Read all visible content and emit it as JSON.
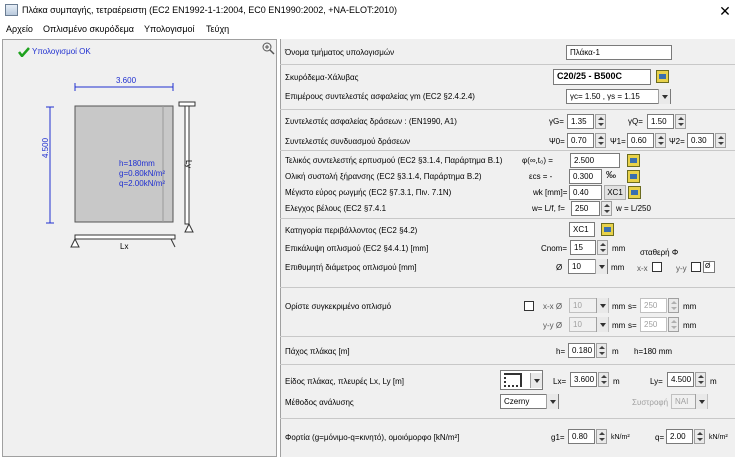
{
  "window": {
    "title": "Πλάκα συμπαγής, τετραέρειστη (EC2 EN1992-1-1:2004, EC0 EN1990:2002, +NA-ELOT:2010)",
    "close_symbol": "✕"
  },
  "menu": {
    "file": "Αρχείο",
    "rebar": "Οπλισμένο σκυρόδεμα",
    "calc": "Υπολογισμοί",
    "docs": "Τεύχη"
  },
  "left": {
    "status": "Υπολογισμοί ΟΚ",
    "dim_top": "3.600",
    "dim_left": "4.500",
    "h_text": "h=180mm",
    "g_text": "g=0.80kN/m²",
    "q_text": "q=2.00kN/m²",
    "lx_label": "Lx",
    "ly_label": "Ly",
    "colors": {
      "slab": "#c8c8c8",
      "dim": "#1f2fd0"
    }
  },
  "section_name": {
    "label": "Όνομα τμήματος υπολογισμών",
    "value": "Πλάκα-1"
  },
  "materials": {
    "label": "Σκυρόδεμα-Χάλυβας",
    "value": "C20/25 - B500C",
    "factors_label": "Επιμέρους συντελεστές ασφαλείας γm (EC2 §2.4.2.4)",
    "factors_value": "γc= 1.50 , γs = 1.15"
  },
  "actions": {
    "safety_label": "Συντελεστές ασφαλείας δράσεων : (EN1990, A1)",
    "gG_label": "γG=",
    "gG": "1.35",
    "gQ_label": "γQ=",
    "gQ": "1.50",
    "comb_label": "Συντελεστές συνδυασμού δράσεων",
    "psi0_label": "Ψ0=",
    "psi0": "0.70",
    "psi1_label": "Ψ1=",
    "psi1": "0.60",
    "psi2_label": "Ψ2=",
    "psi2": "0.30"
  },
  "creep": {
    "creep_label": "Τελικός συντελεστής ερπυσμού (EC2 §3.1.4, Παράρτημα Β.1)",
    "creep_sym": "φ(∞,t₀) =",
    "creep_val": "2.500",
    "shrink_label": "Ολική συστολή ξήρανσης (EC2 §3.1.4, Παράρτημα Β.2)",
    "shrink_sym": "εcs = -",
    "shrink_val": "0.300",
    "shrink_unit": "‰",
    "crack_label": "Μέγιστο εύρος ρωγμής (EC2 §7.3.1, Πιν. 7.1Ν)",
    "crack_sym": "wk [mm]=",
    "crack_val": "0.40",
    "crack_class": "XC1",
    "defl_label": "Ελεγχος βέλους (EC2 §7.4.1",
    "defl_sym": "w= L/f, f=",
    "defl_val": "250",
    "defl_result": "w = L/250"
  },
  "cover": {
    "env_label": "Κατηγορία περιβάλλοντος (EC2 §4.2)",
    "env_val": "XC1",
    "cover_label": "Επικάλυψη οπλισμού (EC2 §4.4.1) [mm]",
    "cover_sym": "Cnom=",
    "cover_val": "15",
    "cover_unit": "mm",
    "const_label": "σταθερή Φ",
    "dia_label": "Επιθυμητή διάμετρος οπλισμού [mm]",
    "dia_sym": "Ø",
    "dia_val": "10",
    "dia_unit": "mm",
    "xx_label": "x-x",
    "yy_label": "y-y",
    "dia_icon": "Ø"
  },
  "specific": {
    "label": "Ορίστε συγκεκριμένο οπλισμό",
    "xx_label": "x-x Ø",
    "xx_dia": "10",
    "xx_s": "250",
    "yy_label": "y-y Ø",
    "yy_dia": "10",
    "yy_s": "250",
    "mm": "mm",
    "s": "s="
  },
  "thickness": {
    "label": "Πάχος πλάκας [m]",
    "sym": "h=",
    "val": "0.180",
    "unit": "m",
    "result": "h=180 mm"
  },
  "slab": {
    "label": "Είδος πλάκας, πλευρές Lx, Ly [m]",
    "lx_sym": "Lx=",
    "lx": "3.600",
    "ly_sym": "Ly=",
    "ly": "4.500",
    "unit": "m",
    "method_label": "Μέθοδος ανάλυσης",
    "method": "Czerny",
    "torsion_label": "Συστροφή",
    "torsion": "NAI"
  },
  "loads": {
    "label": "Φορτία (g=μόνιμο-q=κινητό), ομοιόμορφο  [kN/m²]",
    "g1_sym": "g1=",
    "g1": "0.80",
    "q_sym": "q=",
    "q": "2.00",
    "unit": "kN/m²"
  }
}
